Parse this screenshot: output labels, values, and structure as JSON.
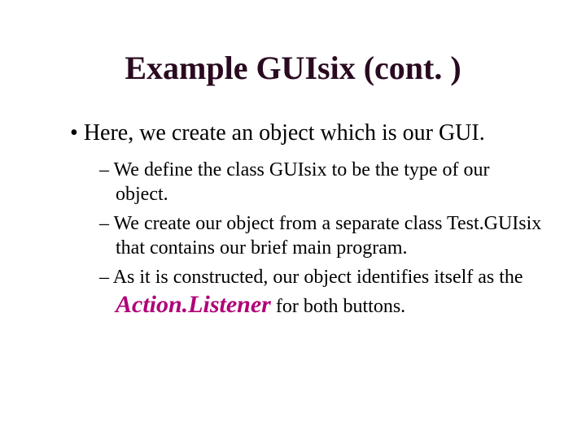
{
  "title": "Example GUIsix (cont. )",
  "bullets": {
    "main": "Here, we create an object which is our GUI.",
    "sub1": "We define the class GUIsix to be the type of our object.",
    "sub2": "We create our object from a separate class Test.GUIsix that contains our brief main program.",
    "sub3_a": "As it is constructed, our object identifies itself as the ",
    "sub3_emph": "Action.Listener",
    "sub3_b": " for both buttons."
  }
}
